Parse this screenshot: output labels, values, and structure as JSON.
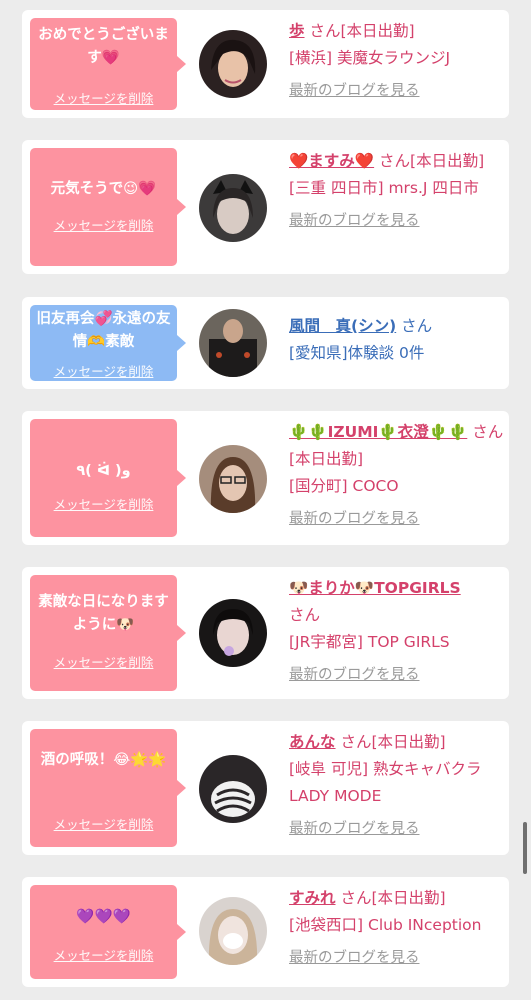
{
  "cards": [
    {
      "bubble_text": "おめでとうございます💗",
      "delete_label": "メッセージを削除",
      "name": "歩",
      "suffix": "さん[本日出勤]",
      "shop": "[横浜] 美魔女ラウンジJ",
      "blog_label": "最新のブログを見る",
      "avatar_icon": "woman-portrait"
    },
    {
      "bubble_text": "元気そうで😉💗",
      "delete_label": "メッセージを削除",
      "name": "❤️ますみ❤️",
      "suffix": "さん[本日出勤]",
      "shop": "[三重 四日市] mrs.J 四日市",
      "blog_label": "最新のブログを見る",
      "avatar_icon": "cat-ear-portrait"
    },
    {
      "bubble_text": "旧友再会💞永遠の友情🫶素敵",
      "delete_label": "メッセージを削除",
      "name": "風間　真(シン)",
      "suffix": "さん",
      "shop": "[愛知県]体験談 0件",
      "blog_label": "",
      "avatar_icon": "man-portrait"
    },
    {
      "bubble_text": "٩( ᐛ )و",
      "delete_label": "メッセージを削除",
      "name": "🌵🌵IZUMI🌵衣澄🌵🌵",
      "suffix": "さん[本日出勤]",
      "shop": "[国分町] COCO",
      "blog_label": "最新のブログを見る",
      "avatar_icon": "woman-glasses-portrait"
    },
    {
      "bubble_text": "素敵な日になりますように🐶",
      "delete_label": "メッセージを削除",
      "name": "🐶まりか🐶TOPGIRLS",
      "suffix": "さん",
      "shop": "[JR宇都宮] TOP GIRLS",
      "blog_label": "最新のブログを見る",
      "avatar_icon": "girl-portrait"
    },
    {
      "bubble_text": "酒の呼吸！😂🌟🌟",
      "delete_label": "メッセージを削除",
      "name": "あんな",
      "suffix": "さん[本日出勤]",
      "shop": "[岐阜 可児] 熟女キャバクラ LADY MODE",
      "blog_label": "最新のブログを見る",
      "avatar_icon": "blurred-portrait"
    },
    {
      "bubble_text": "💜💜💜",
      "delete_label": "メッセージを削除",
      "name": "すみれ",
      "suffix": "さん[本日出勤]",
      "shop": "[池袋西口] Club INception",
      "blog_label": "最新のブログを見る",
      "avatar_icon": "blonde-portrait"
    }
  ]
}
